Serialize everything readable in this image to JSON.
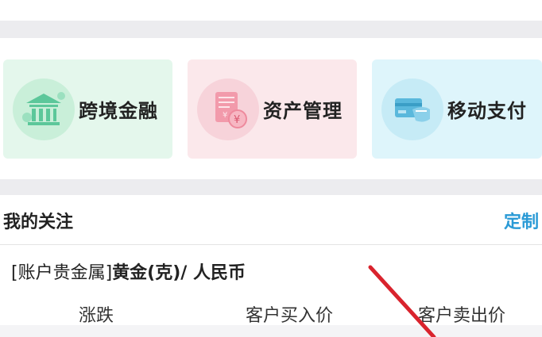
{
  "cards": [
    {
      "label": "跨境金融",
      "icon": "bank-icon",
      "color": "#e4f7ec"
    },
    {
      "label": "资产管理",
      "icon": "asset-document-icon",
      "color": "#fbe8eb"
    },
    {
      "label": "移动支付",
      "icon": "mobile-payment-card-icon",
      "color": "#def5fb"
    }
  ],
  "section": {
    "title": "我的关注",
    "customize": "定制"
  },
  "instrument": {
    "prefix": "[账户贵金属]",
    "name": "黄金(克)/ 人民币"
  },
  "columns": [
    "涨跌",
    "客户买入价",
    "客户卖出价"
  ],
  "colors": {
    "accent": "#2a9ad6",
    "annotation": "#d9232d",
    "divider_band": "#ececef"
  }
}
